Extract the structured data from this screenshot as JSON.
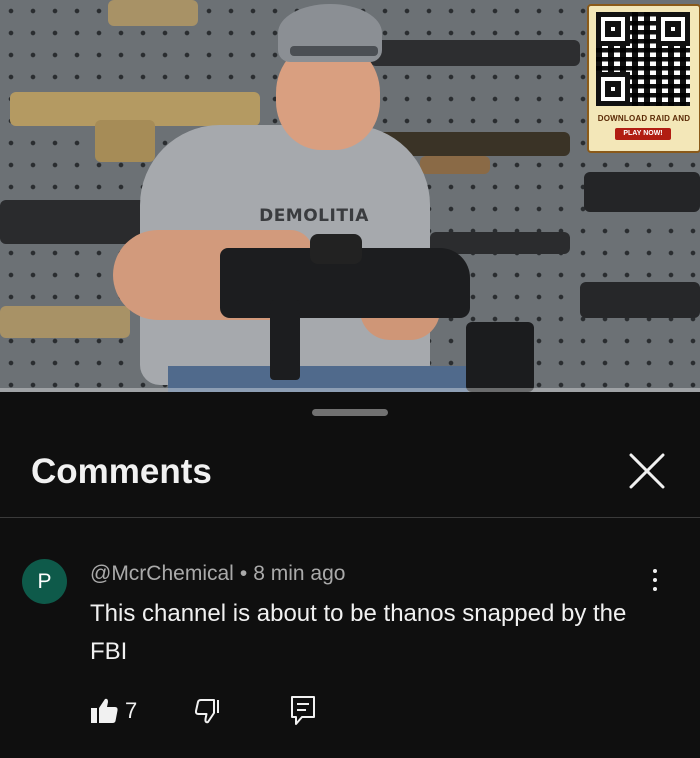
{
  "video": {
    "shirt_text": "DEMOLITIA",
    "ad": {
      "title": "DOWNLOAD RAID AND",
      "cta": "PLAY NOW!"
    },
    "progress": 0.0
  },
  "comments_panel": {
    "title": "Comments",
    "close_icon": "close-icon"
  },
  "comment": {
    "avatar_letter": "P",
    "author": "@McrChemical",
    "separator": "•",
    "time": "8 min ago",
    "text": "This channel is about to be thanos snapped by the FBI",
    "likes": "7"
  },
  "colors": {
    "background": "#0f0f0f",
    "text": "#f1f1f1",
    "secondary_text": "#aaaaaa",
    "avatar": "#0e5a4a",
    "divider": "#3a3a3a"
  },
  "icons": [
    "like-icon",
    "dislike-icon",
    "reply-icon",
    "more-vert-icon",
    "close-icon"
  ]
}
